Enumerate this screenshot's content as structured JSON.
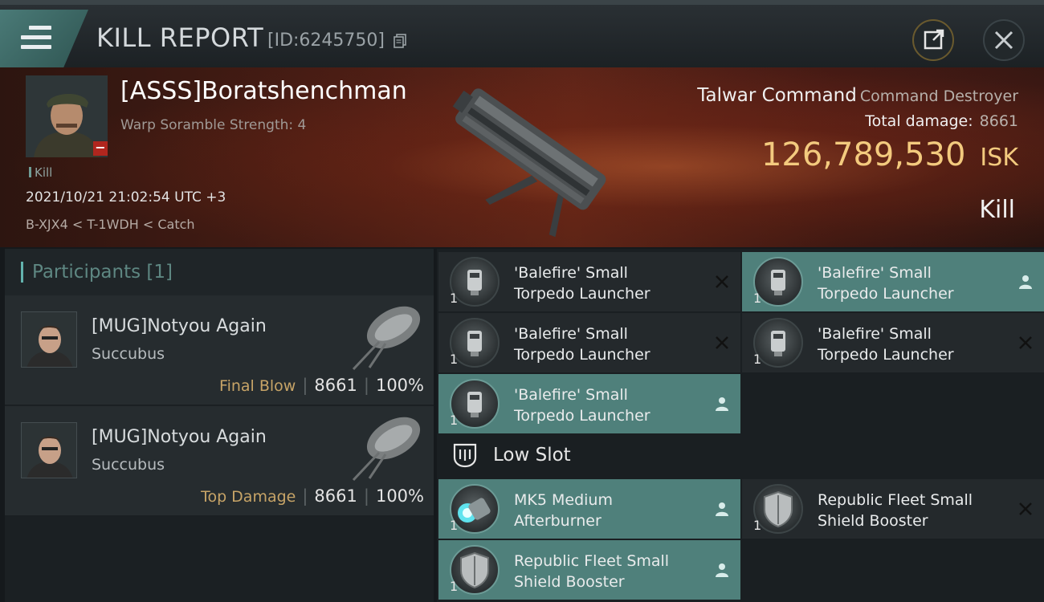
{
  "header": {
    "title": "KILL REPORT",
    "report_id": "[ID:6245750]"
  },
  "victim": {
    "name": "[ASSS]Boratshenchman",
    "warp_scramble": "Warp Soramble Strength: 4",
    "tag": "Kill",
    "datetime": "2021/10/21 21:02:54 UTC +3",
    "location": "B-XJX4 < T-1WDH < Catch",
    "ship_name": "Talwar Command",
    "ship_class": "Command Destroyer",
    "total_damage_label": "Total damage:",
    "total_damage": "8661",
    "isk_value": "126,789,530",
    "isk_unit": "ISK",
    "result": "Kill"
  },
  "participants": {
    "label": "Participants [1]",
    "rows": [
      {
        "name": "[MUG]Notyou Again",
        "ship": "Succubus",
        "tag": "Final Blow",
        "damage": "8661",
        "percent": "100%"
      },
      {
        "name": "[MUG]Notyou Again",
        "ship": "Succubus",
        "tag": "Top Damage",
        "damage": "8661",
        "percent": "100%"
      }
    ]
  },
  "modules": {
    "items": [
      {
        "name_line1": "'Balefire' Small",
        "name_line2": "Torpedo Launcher",
        "qty": "1",
        "status": "destroyed",
        "icon": "torpedo-launcher-icon"
      },
      {
        "name_line1": "'Balefire' Small",
        "name_line2": "Torpedo Launcher",
        "qty": "1",
        "status": "dropped",
        "icon": "torpedo-launcher-icon"
      },
      {
        "name_line1": "'Balefire' Small",
        "name_line2": "Torpedo Launcher",
        "qty": "1",
        "status": "destroyed",
        "icon": "torpedo-launcher-icon"
      },
      {
        "name_line1": "'Balefire' Small",
        "name_line2": "Torpedo Launcher",
        "qty": "1",
        "status": "destroyed",
        "icon": "torpedo-launcher-icon"
      },
      {
        "name_line1": "'Balefire' Small",
        "name_line2": "Torpedo Launcher",
        "qty": "1",
        "status": "dropped",
        "icon": "torpedo-launcher-icon"
      },
      {
        "name_line1": "MK5 Medium",
        "name_line2": "Afterburner",
        "qty": "1",
        "status": "dropped",
        "icon": "afterburner-icon"
      },
      {
        "name_line1": "Republic Fleet Small",
        "name_line2": "Shield Booster",
        "qty": "1",
        "status": "destroyed",
        "icon": "shield-booster-icon"
      },
      {
        "name_line1": "Republic Fleet Small",
        "name_line2": "Shield Booster",
        "qty": "1",
        "status": "dropped",
        "icon": "shield-booster-icon"
      }
    ],
    "low_slot_label": "Low Slot"
  },
  "colors": {
    "accent_teal": "#4f807b",
    "isk_gold": "#f3ca7e",
    "tag_gold": "#c7a467"
  }
}
